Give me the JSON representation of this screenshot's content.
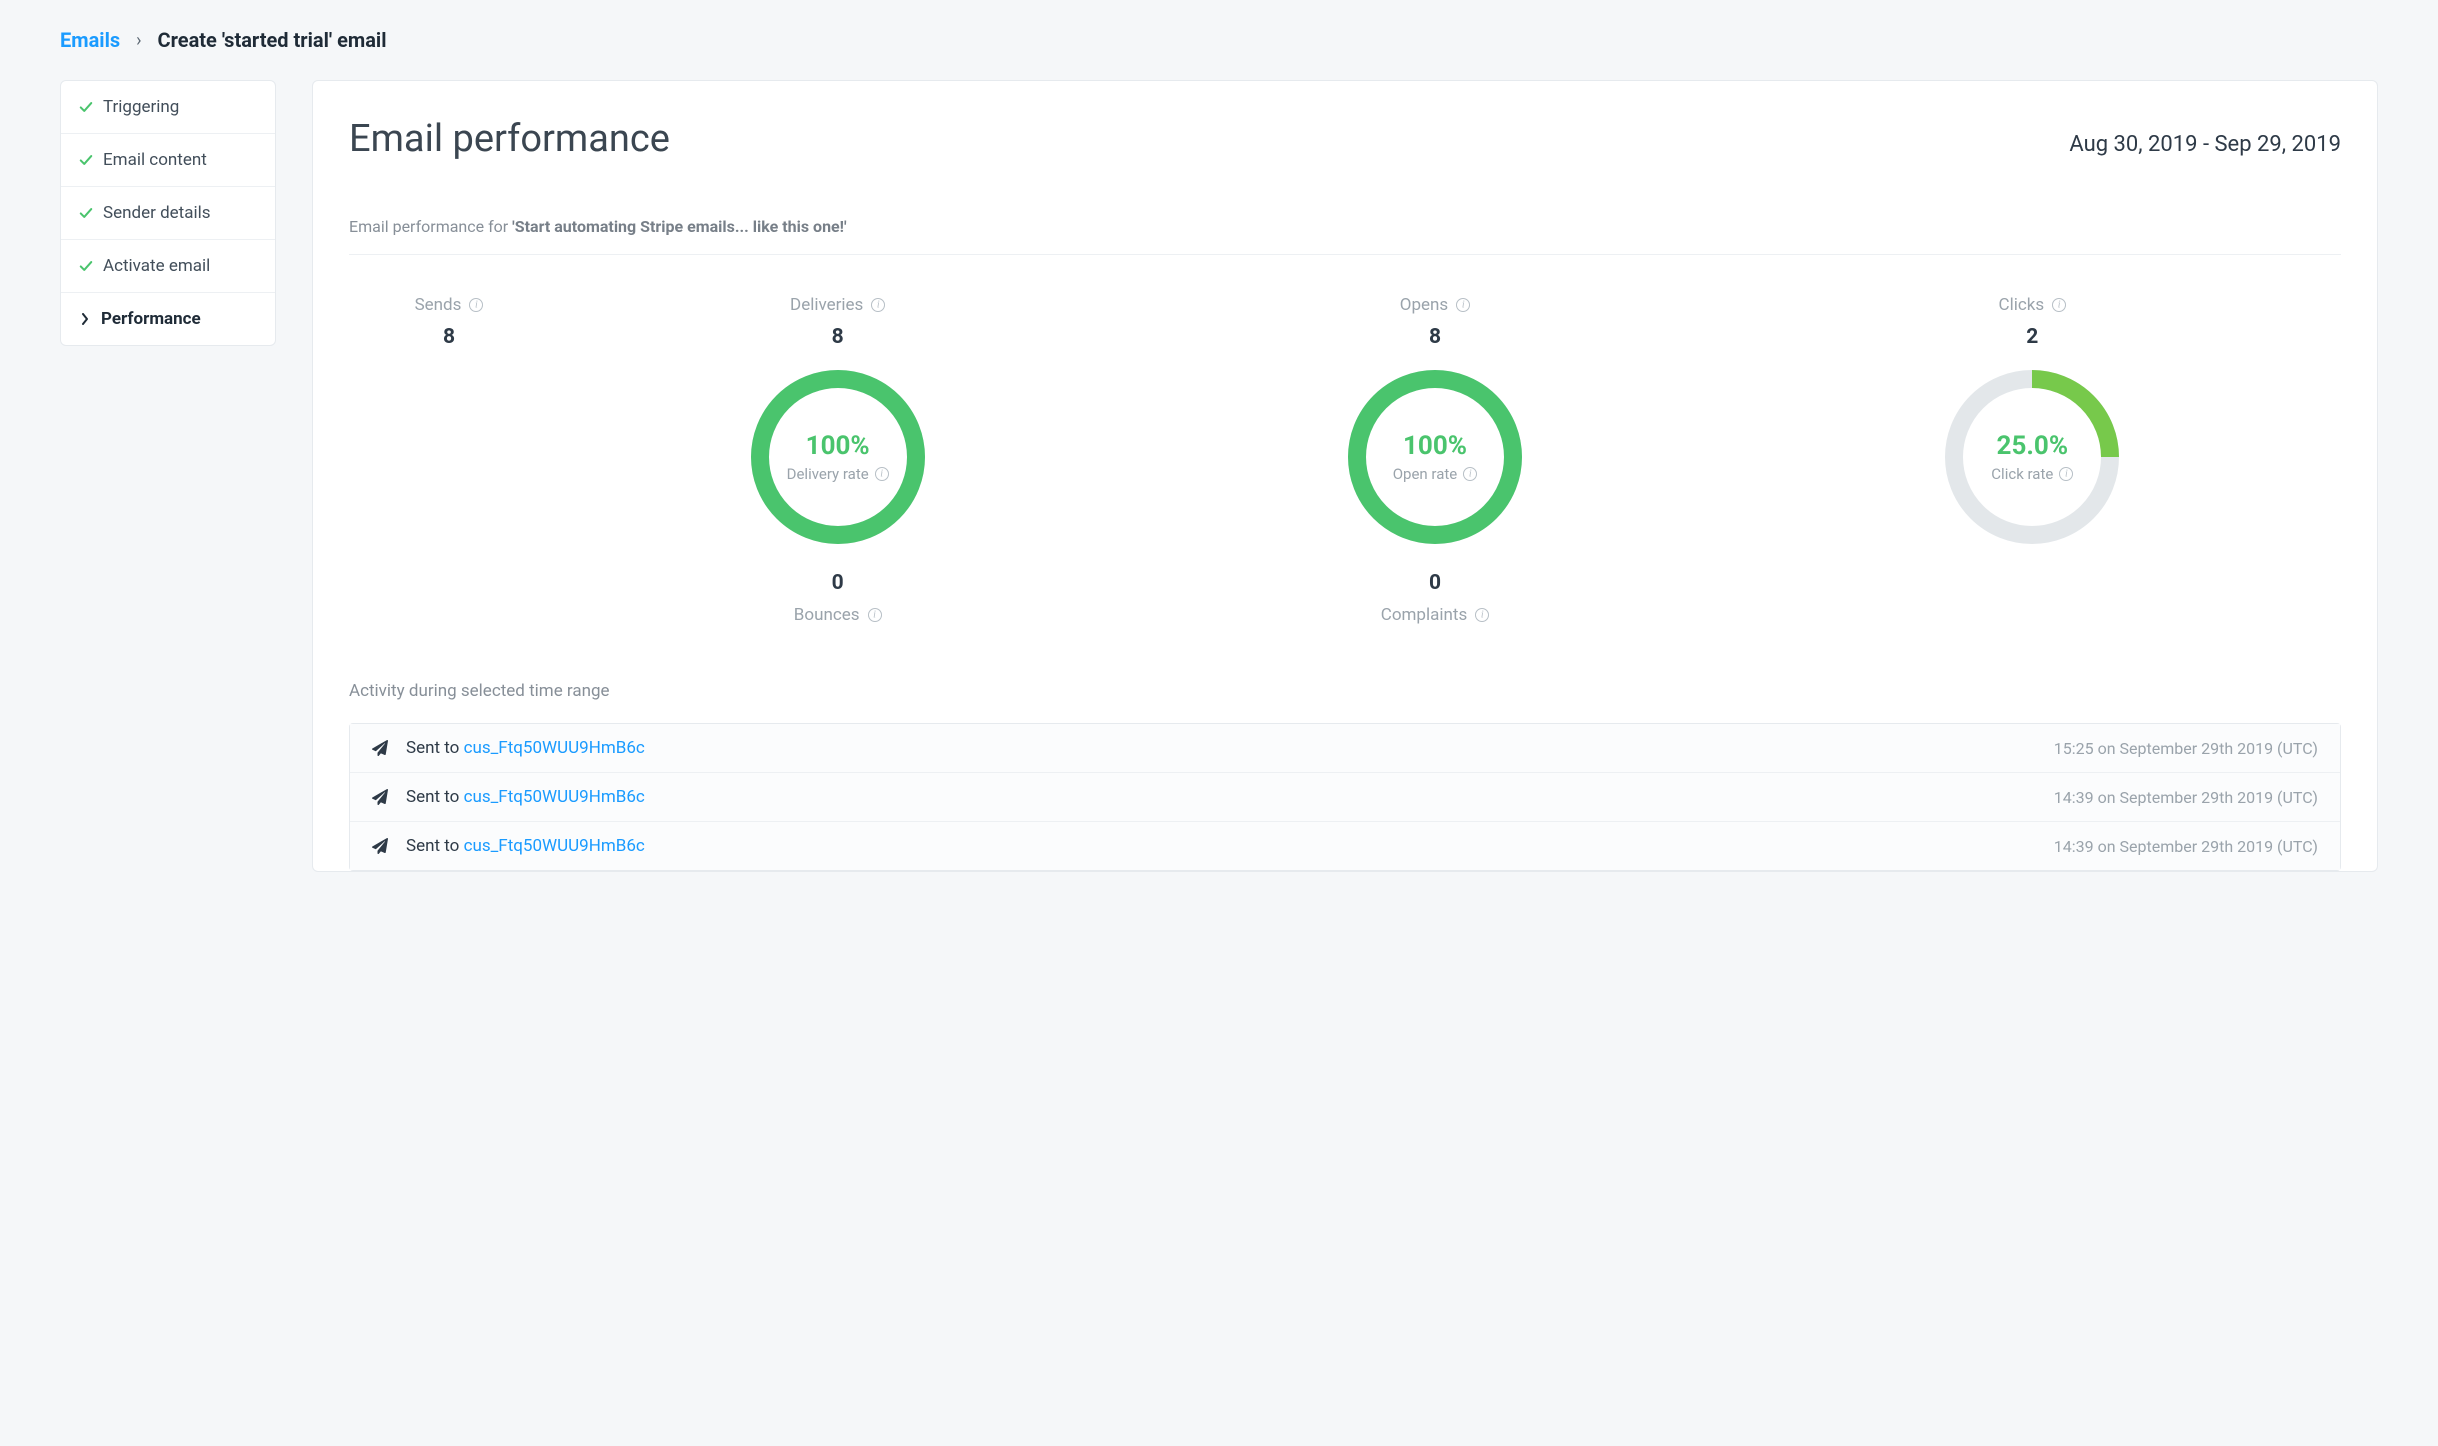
{
  "breadcrumb": {
    "root": "Emails",
    "current": "Create 'started trial' email"
  },
  "sidebar": {
    "items": [
      {
        "label": "Triggering",
        "done": true,
        "active": false
      },
      {
        "label": "Email content",
        "done": true,
        "active": false
      },
      {
        "label": "Sender details",
        "done": true,
        "active": false
      },
      {
        "label": "Activate email",
        "done": true,
        "active": false
      },
      {
        "label": "Performance",
        "done": false,
        "active": true
      }
    ]
  },
  "header": {
    "title": "Email performance",
    "date_range": "Aug 30, 2019 - Sep 29, 2019"
  },
  "subtitle": {
    "prefix": "Email performance for ",
    "name": "'Start automating Stripe emails... like this one!'"
  },
  "metrics": {
    "sends": {
      "label": "Sends",
      "value": "8"
    },
    "deliveries": {
      "label": "Deliveries",
      "value": "8"
    },
    "opens": {
      "label": "Opens",
      "value": "8"
    },
    "clicks": {
      "label": "Clicks",
      "value": "2"
    },
    "bounces": {
      "label": "Bounces",
      "value": "0"
    },
    "complaints": {
      "label": "Complaints",
      "value": "0"
    }
  },
  "chart_data": [
    {
      "type": "pie",
      "label": "Delivery rate",
      "pct_text": "100%",
      "pct": 100.0
    },
    {
      "type": "pie",
      "label": "Open rate",
      "pct_text": "100%",
      "pct": 100.0
    },
    {
      "type": "pie",
      "label": "Click rate",
      "pct_text": "25.0%",
      "pct": 25.0
    }
  ],
  "activity": {
    "title": "Activity during selected time range",
    "sent_prefix": "Sent to ",
    "rows": [
      {
        "customer": "cus_Ftq50WUU9HmB6c",
        "time": "15:25 on September 29th 2019 (UTC)"
      },
      {
        "customer": "cus_Ftq50WUU9HmB6c",
        "time": "14:39 on September 29th 2019 (UTC)"
      },
      {
        "customer": "cus_Ftq50WUU9HmB6c",
        "time": "14:39 on September 29th 2019 (UTC)"
      }
    ]
  },
  "colors": {
    "accent_green": "#4ac46d",
    "accent_green_light": "#77c94b",
    "ring_bg": "#e3e7ea",
    "link_blue": "#1a9bff"
  }
}
